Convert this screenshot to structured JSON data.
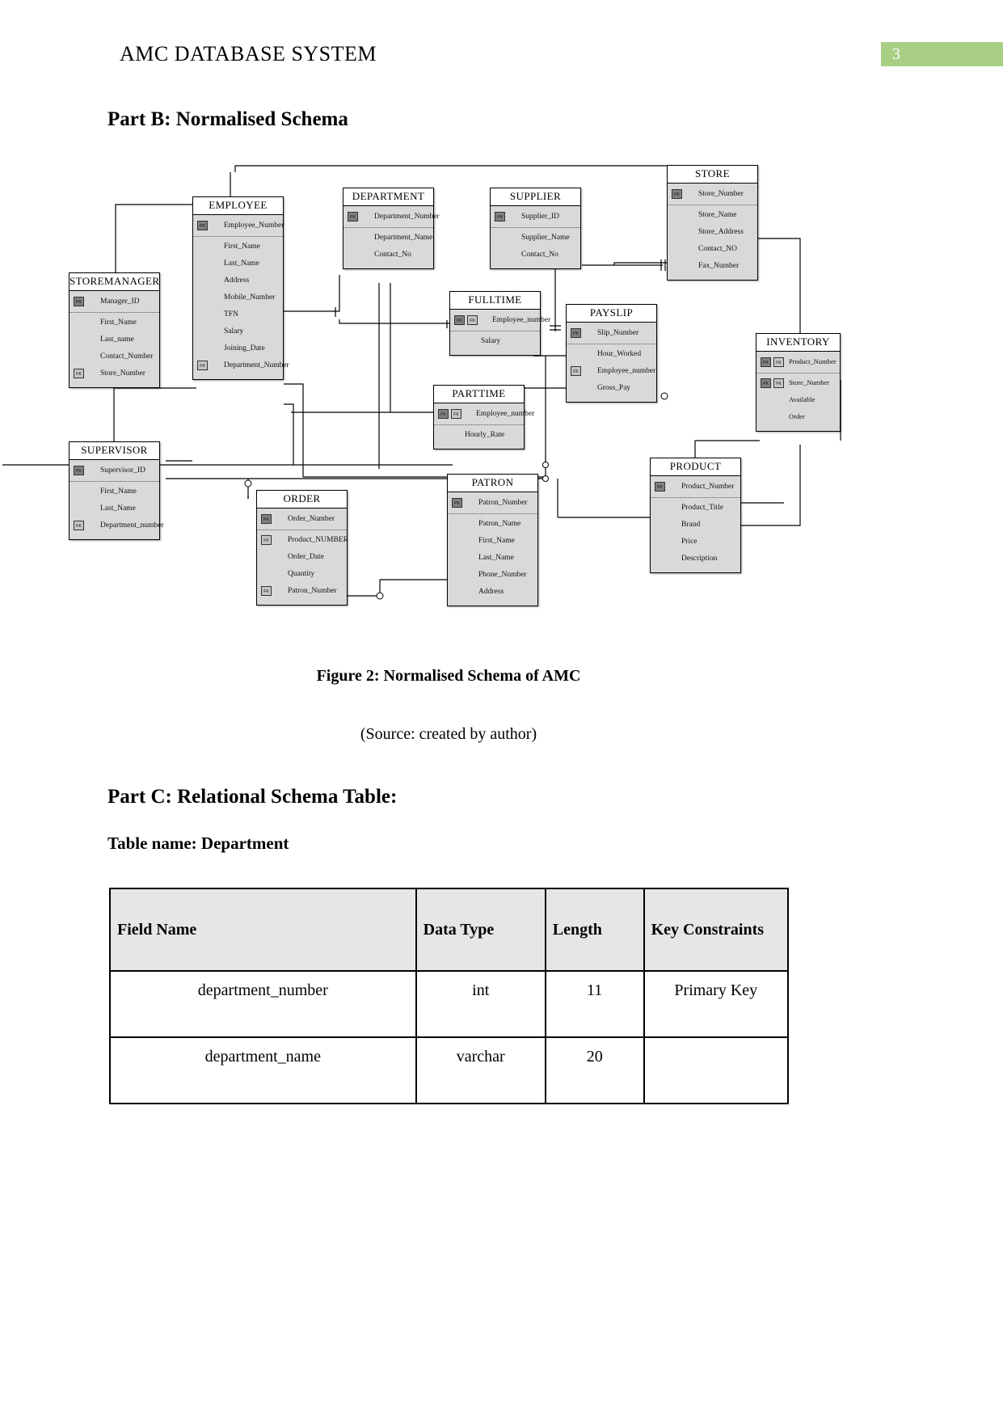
{
  "header": {
    "title": "AMC DATABASE SYSTEM",
    "page_number": "3",
    "badge_color": "#a8cf84"
  },
  "sections": {
    "part_b_heading": "Part B: Normalised Schema",
    "figure_caption": "Figure 2: Normalised Schema of AMC",
    "figure_source": "(Source: created by author)",
    "part_c_heading": "Part C: Relational Schema Table:",
    "table_name_label": "Table name: Department"
  },
  "diagram": {
    "entities": [
      {
        "name": "STORE",
        "attributes": [
          {
            "label": "Store_Number",
            "key": "PK"
          },
          {
            "label": "Store_Name",
            "key": ""
          },
          {
            "label": "Store_Address",
            "key": ""
          },
          {
            "label": "Contact_NO",
            "key": ""
          },
          {
            "label": "Fax_Number",
            "key": ""
          }
        ]
      },
      {
        "name": "EMPLOYEE",
        "attributes": [
          {
            "label": "Employee_Number",
            "key": "PK"
          },
          {
            "label": "First_Name",
            "key": ""
          },
          {
            "label": "Last_Name",
            "key": ""
          },
          {
            "label": "Address",
            "key": ""
          },
          {
            "label": "Mobile_Number",
            "key": ""
          },
          {
            "label": "TFN",
            "key": ""
          },
          {
            "label": "Salary",
            "key": ""
          },
          {
            "label": "Joining_Date",
            "key": ""
          },
          {
            "label": "Department_Number",
            "key": "FK"
          }
        ]
      },
      {
        "name": "DEPARTMENT",
        "attributes": [
          {
            "label": "Department_Number",
            "key": "PK"
          },
          {
            "label": "Department_Name",
            "key": ""
          },
          {
            "label": "Contact_No",
            "key": ""
          }
        ]
      },
      {
        "name": "SUPPLIER",
        "attributes": [
          {
            "label": "Supplier_ID",
            "key": "PK"
          },
          {
            "label": "Supplier_Name",
            "key": ""
          },
          {
            "label": "Contact_No",
            "key": ""
          }
        ]
      },
      {
        "name": "STOREMANAGER",
        "attributes": [
          {
            "label": "Manager_ID",
            "key": "PK"
          },
          {
            "label": "First_Name",
            "key": ""
          },
          {
            "label": "Last_name",
            "key": ""
          },
          {
            "label": "Contact_Number",
            "key": ""
          },
          {
            "label": "Store_Number",
            "key": "FK"
          }
        ]
      },
      {
        "name": "FULLTIME",
        "attributes": [
          {
            "label": "Employee_number",
            "key": "PKFK"
          },
          {
            "label": "Salary",
            "key": ""
          }
        ]
      },
      {
        "name": "PAYSLIP",
        "attributes": [
          {
            "label": "Slip_Number",
            "key": "PK"
          },
          {
            "label": "Hour_Worked",
            "key": ""
          },
          {
            "label": "Employee_number",
            "key": "FK"
          },
          {
            "label": "Gross_Pay",
            "key": ""
          }
        ]
      },
      {
        "name": "INVENTORY",
        "attributes": [
          {
            "label": "Product_Number",
            "key": "PKFK"
          },
          {
            "label": "Store_Number",
            "key": "PKFK"
          },
          {
            "label": "Available",
            "key": ""
          },
          {
            "label": "Order",
            "key": ""
          }
        ]
      },
      {
        "name": "PARTTIME",
        "attributes": [
          {
            "label": "Employee_number",
            "key": "PKFK"
          },
          {
            "label": "Hourly_Rate",
            "key": ""
          }
        ]
      },
      {
        "name": "SUPERVISOR",
        "attributes": [
          {
            "label": "Supervisor_ID",
            "key": "PK"
          },
          {
            "label": "First_Name",
            "key": ""
          },
          {
            "label": "Last_Name",
            "key": ""
          },
          {
            "label": "Department_number",
            "key": "FK"
          }
        ]
      },
      {
        "name": "ORDER",
        "attributes": [
          {
            "label": "Order_Number",
            "key": "PK"
          },
          {
            "label": "Product_NUMBER",
            "key": "FK"
          },
          {
            "label": "Order_Date",
            "key": ""
          },
          {
            "label": "Quantity",
            "key": ""
          },
          {
            "label": "Patron_Number",
            "key": "FK"
          }
        ]
      },
      {
        "name": "PATRON",
        "attributes": [
          {
            "label": "Patron_Number",
            "key": "PK"
          },
          {
            "label": "Patron_Name",
            "key": ""
          },
          {
            "label": "First_Name",
            "key": ""
          },
          {
            "label": "Last_Name",
            "key": ""
          },
          {
            "label": "Phone_Number",
            "key": ""
          },
          {
            "label": "Address",
            "key": ""
          }
        ]
      },
      {
        "name": "PRODUCT",
        "attributes": [
          {
            "label": "Product_Number",
            "key": "PK"
          },
          {
            "label": "Product_Title",
            "key": ""
          },
          {
            "label": "Brand",
            "key": ""
          },
          {
            "label": "Price",
            "key": ""
          },
          {
            "label": "Description",
            "key": ""
          }
        ]
      }
    ],
    "key_badges": {
      "pk": "PK",
      "fk": "FK"
    }
  },
  "relational_table": {
    "headers": [
      "Field Name",
      "Data Type",
      "Length",
      "Key Constraints"
    ],
    "rows": [
      [
        "department_number",
        "int",
        "11",
        "Primary Key"
      ],
      [
        "department_name",
        "varchar",
        "20",
        ""
      ]
    ]
  }
}
